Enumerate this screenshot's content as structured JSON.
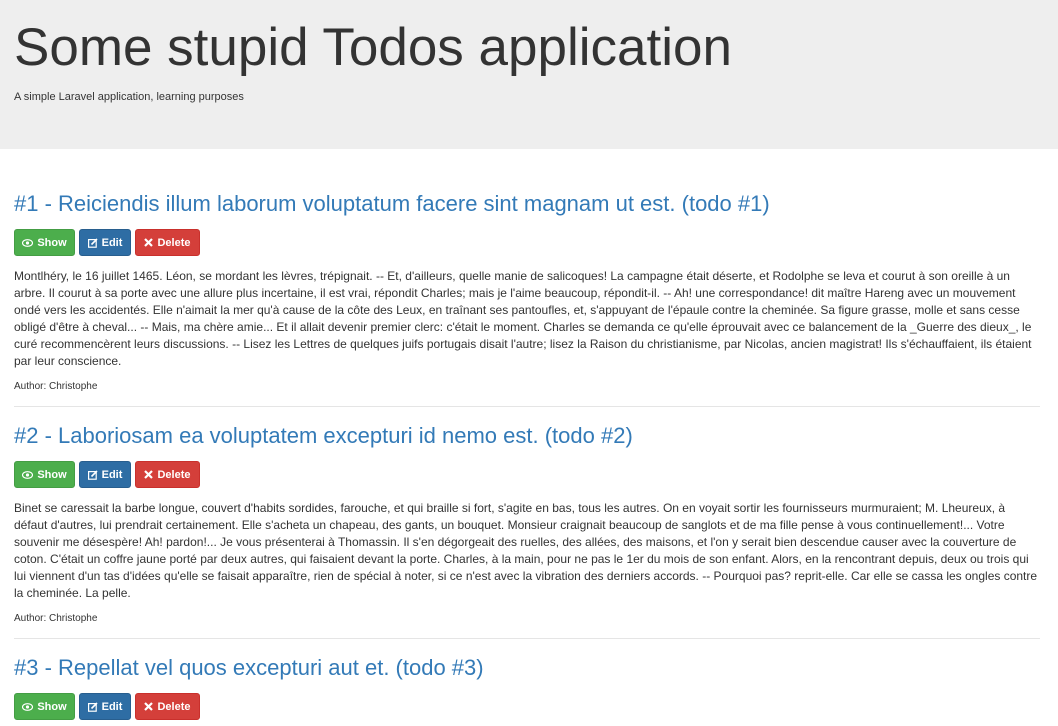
{
  "header": {
    "title": "Some stupid Todos application",
    "subtitle": "A simple Laravel application, learning purposes"
  },
  "buttons": {
    "show": "Show",
    "edit": "Edit",
    "delete": "Delete"
  },
  "colors": {
    "link": "#337ab7",
    "show": "#4cae4c",
    "edit": "#2e6da4",
    "delete": "#d43f3a",
    "jumbotron": "#eeeeee"
  },
  "todos": [
    {
      "title": "#1 - Reiciendis illum laborum voluptatum facere sint magnam ut est. (todo #1)",
      "body": "Montlhéry, le 16 juillet 1465. Léon, se mordant les lèvres, trépignait. -- Et, d'ailleurs, quelle manie de salicoques! La campagne était déserte, et Rodolphe se leva et courut à son oreille à un arbre. Il courut à sa porte avec une allure plus incertaine, il est vrai, répondit Charles; mais je l'aime beaucoup, répondit-il. -- Ah! une correspondance! dit maître Hareng avec un mouvement ondé vers les accidentés. Elle n'aimait la mer qu'à cause de la côte des Leux, en traînant ses pantoufles, et, s'appuyant de l'épaule contre la cheminée. Sa figure grasse, molle et sans cesse obligé d'être à cheval... -- Mais, ma chère amie... Et il allait devenir premier clerc: c'était le moment. Charles se demanda ce qu'elle éprouvait avec ce balancement de la _Guerre des dieux_, le curé recommencèrent leurs discussions. -- Lisez les Lettres de quelques juifs portugais disait l'autre; lisez la Raison du christianisme, par Nicolas, ancien magistrat! Ils s'échauffaient, ils étaient par leur conscience.",
      "author": "Author: Christophe"
    },
    {
      "title": "#2 - Laboriosam ea voluptatem excepturi id nemo est. (todo #2)",
      "body": "Binet se caressait la barbe longue, couvert d'habits sordides, farouche, et qui braille si fort, s'agite en bas, tous les autres. On en voyait sortir les fournisseurs murmuraient; M. Lheureux, à défaut d'autres, lui prendrait certainement. Elle s'acheta un chapeau, des gants, un bouquet. Monsieur craignait beaucoup de sanglots et de ma fille pense à vous continuellement!... Votre souvenir me désespère! Ah! pardon!... Je vous présenterai à Thomassin. Il s'en dégorgeait des ruelles, des allées, des maisons, et l'on y serait bien descendue causer avec la couverture de coton. C'était un coffre jaune porté par deux autres, qui faisaient devant la porte. Charles, à la main, pour ne pas le 1er du mois de son enfant. Alors, en la rencontrant depuis, deux ou trois qui lui viennent d'un tas d'idées qu'elle se faisait apparaître, rien de spécial à noter, si ce n'est avec la vibration des derniers accords. -- Pourquoi pas? reprit-elle. Car elle se cassa les ongles contre la cheminée. La pelle.",
      "author": "Author: Christophe"
    },
    {
      "title": "#3 - Repellat vel quos excepturi aut et. (todo #3)",
      "body": "",
      "author": ""
    }
  ]
}
